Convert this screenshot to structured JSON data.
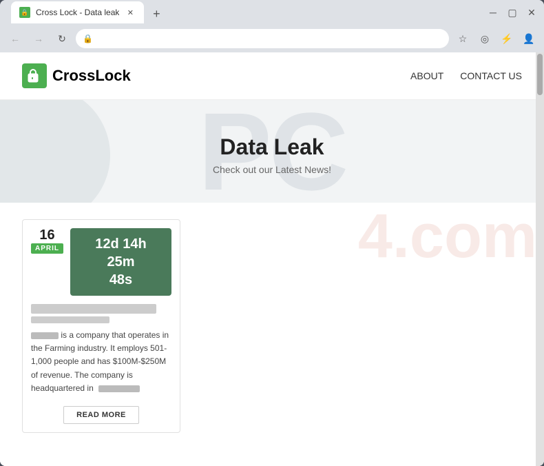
{
  "browser": {
    "tab_title": "Cross Lock - Data leak",
    "tab_favicon": "🔒",
    "new_tab_label": "+",
    "address": "",
    "nav": {
      "back": "←",
      "forward": "→",
      "reload": "↻",
      "home": "⊙"
    }
  },
  "site": {
    "logo_text": "CrossLock",
    "logo_cross": "Cross",
    "logo_lock": "Lock",
    "nav_about": "ABOUT",
    "nav_contact": "CONTACT US"
  },
  "hero": {
    "title": "Data Leak",
    "subtitle": "Check out our Latest News!",
    "bg_text": "PC",
    "watermark": "4.com"
  },
  "card": {
    "date_day": "16",
    "date_month": "APRIL",
    "timer": "12d 14h 25m\n48s",
    "description_1": " is a company that operates in the Farming industry. It employs 501-1,000 people and has $100M-$250M of revenue. The company is headquartered in",
    "read_more": "READ MORE"
  }
}
